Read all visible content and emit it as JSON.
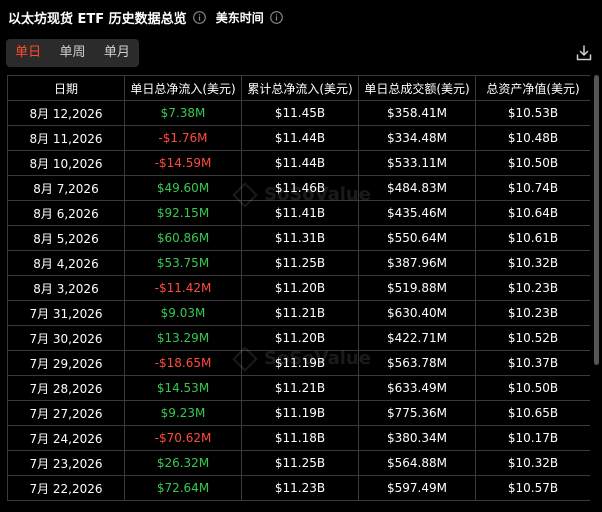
{
  "header": {
    "title": "以太坊现货 ETF 历史数据总览",
    "timezone": "美东时间"
  },
  "tabs": [
    {
      "label": "单日",
      "active": true
    },
    {
      "label": "单周",
      "active": false
    },
    {
      "label": "单月",
      "active": false
    }
  ],
  "colors": {
    "accent": "#ff4a2e",
    "positive": "#37c852",
    "negative": "#ff4b3e"
  },
  "table": {
    "columns": [
      "日期",
      "单日总净流入(美元)",
      "累计总净流入(美元)",
      "单日总成交额(美元)",
      "总资产净值(美元)"
    ],
    "rows": [
      [
        "8月 12,2026",
        "$7.38M",
        "$11.45B",
        "$358.41M",
        "$10.53B"
      ],
      [
        "8月 11,2026",
        "-$1.76M",
        "$11.44B",
        "$334.48M",
        "$10.48B"
      ],
      [
        "8月 10,2026",
        "-$14.59M",
        "$11.44B",
        "$533.11M",
        "$10.50B"
      ],
      [
        "8月 7,2026",
        "$49.60M",
        "$11.46B",
        "$484.83M",
        "$10.74B"
      ],
      [
        "8月 6,2026",
        "$92.15M",
        "$11.41B",
        "$435.46M",
        "$10.64B"
      ],
      [
        "8月 5,2026",
        "$60.86M",
        "$11.31B",
        "$550.64M",
        "$10.61B"
      ],
      [
        "8月 4,2026",
        "$53.75M",
        "$11.25B",
        "$387.96M",
        "$10.32B"
      ],
      [
        "8月 3,2026",
        "-$11.42M",
        "$11.20B",
        "$519.88M",
        "$10.23B"
      ],
      [
        "7月 31,2026",
        "$9.03M",
        "$11.21B",
        "$630.40M",
        "$10.23B"
      ],
      [
        "7月 30,2026",
        "$13.29M",
        "$11.20B",
        "$422.71M",
        "$10.52B"
      ],
      [
        "7月 29,2026",
        "-$18.65M",
        "$11.19B",
        "$563.78M",
        "$10.37B"
      ],
      [
        "7月 28,2026",
        "$14.53M",
        "$11.21B",
        "$633.49M",
        "$10.50B"
      ],
      [
        "7月 27,2026",
        "$9.23M",
        "$11.19B",
        "$775.36M",
        "$10.65B"
      ],
      [
        "7月 24,2026",
        "-$70.62M",
        "$11.18B",
        "$380.34M",
        "$10.17B"
      ],
      [
        "7月 23,2026",
        "$26.32M",
        "$11.25B",
        "$564.88M",
        "$10.32B"
      ],
      [
        "7月 22,2026",
        "$72.64M",
        "$11.23B",
        "$597.49M",
        "$10.57B"
      ]
    ]
  },
  "watermark": "SoSoValue"
}
